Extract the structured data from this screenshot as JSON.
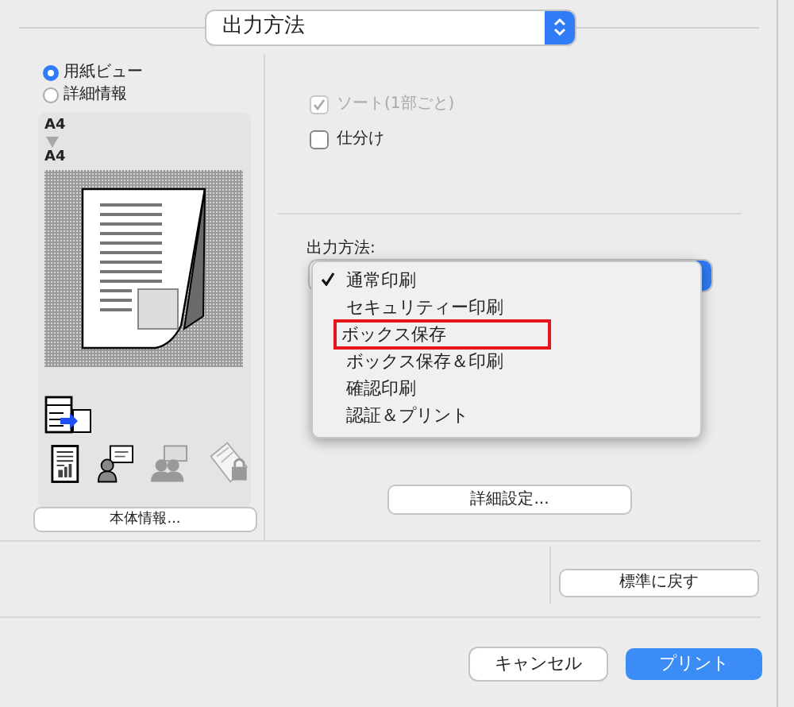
{
  "top_popup": {
    "value": "出力方法"
  },
  "view_options": [
    {
      "label": "用紙ビュー",
      "selected": true
    },
    {
      "label": "詳細情報",
      "selected": false
    }
  ],
  "preview": {
    "input_size": "A4",
    "output_size": "A4"
  },
  "info_button": "本体情報...",
  "checkboxes": [
    {
      "label": "ソート(1部ごと)",
      "checked": true,
      "disabled": true
    },
    {
      "label": "仕分け",
      "checked": false,
      "disabled": false
    }
  ],
  "output_method": {
    "label": "出力方法:",
    "menu": [
      {
        "label": "通常印刷",
        "selected": true,
        "annotated": false
      },
      {
        "label": "セキュリティー印刷",
        "selected": false,
        "annotated": false
      },
      {
        "label": "ボックス保存",
        "selected": false,
        "annotated": true
      },
      {
        "label": "ボックス保存＆印刷",
        "selected": false,
        "annotated": false
      },
      {
        "label": "確認印刷",
        "selected": false,
        "annotated": false
      },
      {
        "label": "認証＆プリント",
        "selected": false,
        "annotated": false
      }
    ]
  },
  "details_button": "詳細設定...",
  "reset_button": "標準に戻す",
  "buttons": [
    {
      "label": "キャンセル",
      "kind": "secondary"
    },
    {
      "label": "プリント",
      "kind": "primary"
    }
  ]
}
